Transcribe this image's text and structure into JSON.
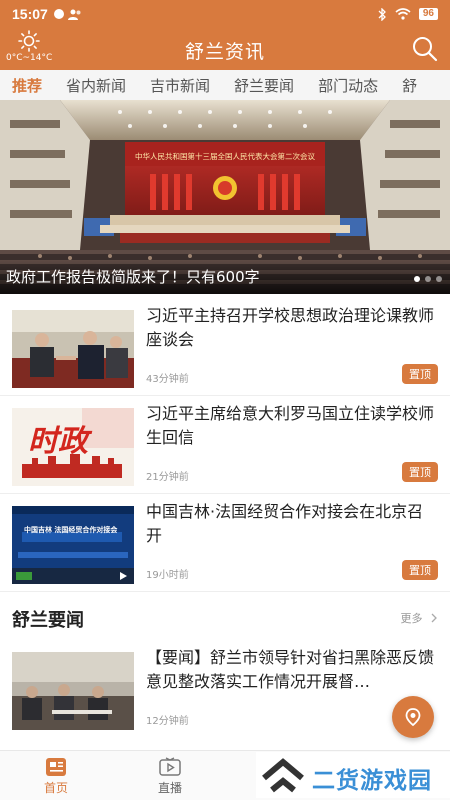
{
  "status_bar": {
    "time": "15:07",
    "battery": "96"
  },
  "header": {
    "title": "舒兰资讯",
    "temperature": "0°C~14°C"
  },
  "tabs": [
    {
      "label": "推荐",
      "active": true
    },
    {
      "label": "省内新闻"
    },
    {
      "label": "吉市新闻"
    },
    {
      "label": "舒兰要闻"
    },
    {
      "label": "部门动态"
    },
    {
      "label": "舒"
    }
  ],
  "hero": {
    "caption": "政府工作报告极简版来了！只有600字",
    "banner_text": "中华人民共和国第十三届全国人民代表大会第二次会议"
  },
  "news": [
    {
      "title": "习近平主持召开学校思想政治理论课教师座谈会",
      "time": "43分钟前",
      "badge": "置顶"
    },
    {
      "title": "习近平主席给意大利罗马国立住读学校师生回信",
      "time": "21分钟前",
      "badge": "置顶",
      "thumb_text": "时政"
    },
    {
      "title": "中国吉林·法国经贸合作对接会在北京召开",
      "time": "19小时前",
      "badge": "置顶",
      "thumb_text": "中国吉林 法国经贸合作对接会"
    },
    {
      "title": "【要闻】舒兰市领导针对省扫黑除恶反馈意见整改落实工作情况开展督…",
      "time": "12分钟前"
    }
  ],
  "section": {
    "title": "舒兰要闻",
    "more": "更多"
  },
  "bottom_nav": [
    {
      "label": "首页",
      "active": true
    },
    {
      "label": "直播"
    }
  ],
  "watermark": {
    "text": "二货游戏园"
  },
  "colors": {
    "accent": "#d87a3e",
    "watermark": "#3a8fd6"
  }
}
